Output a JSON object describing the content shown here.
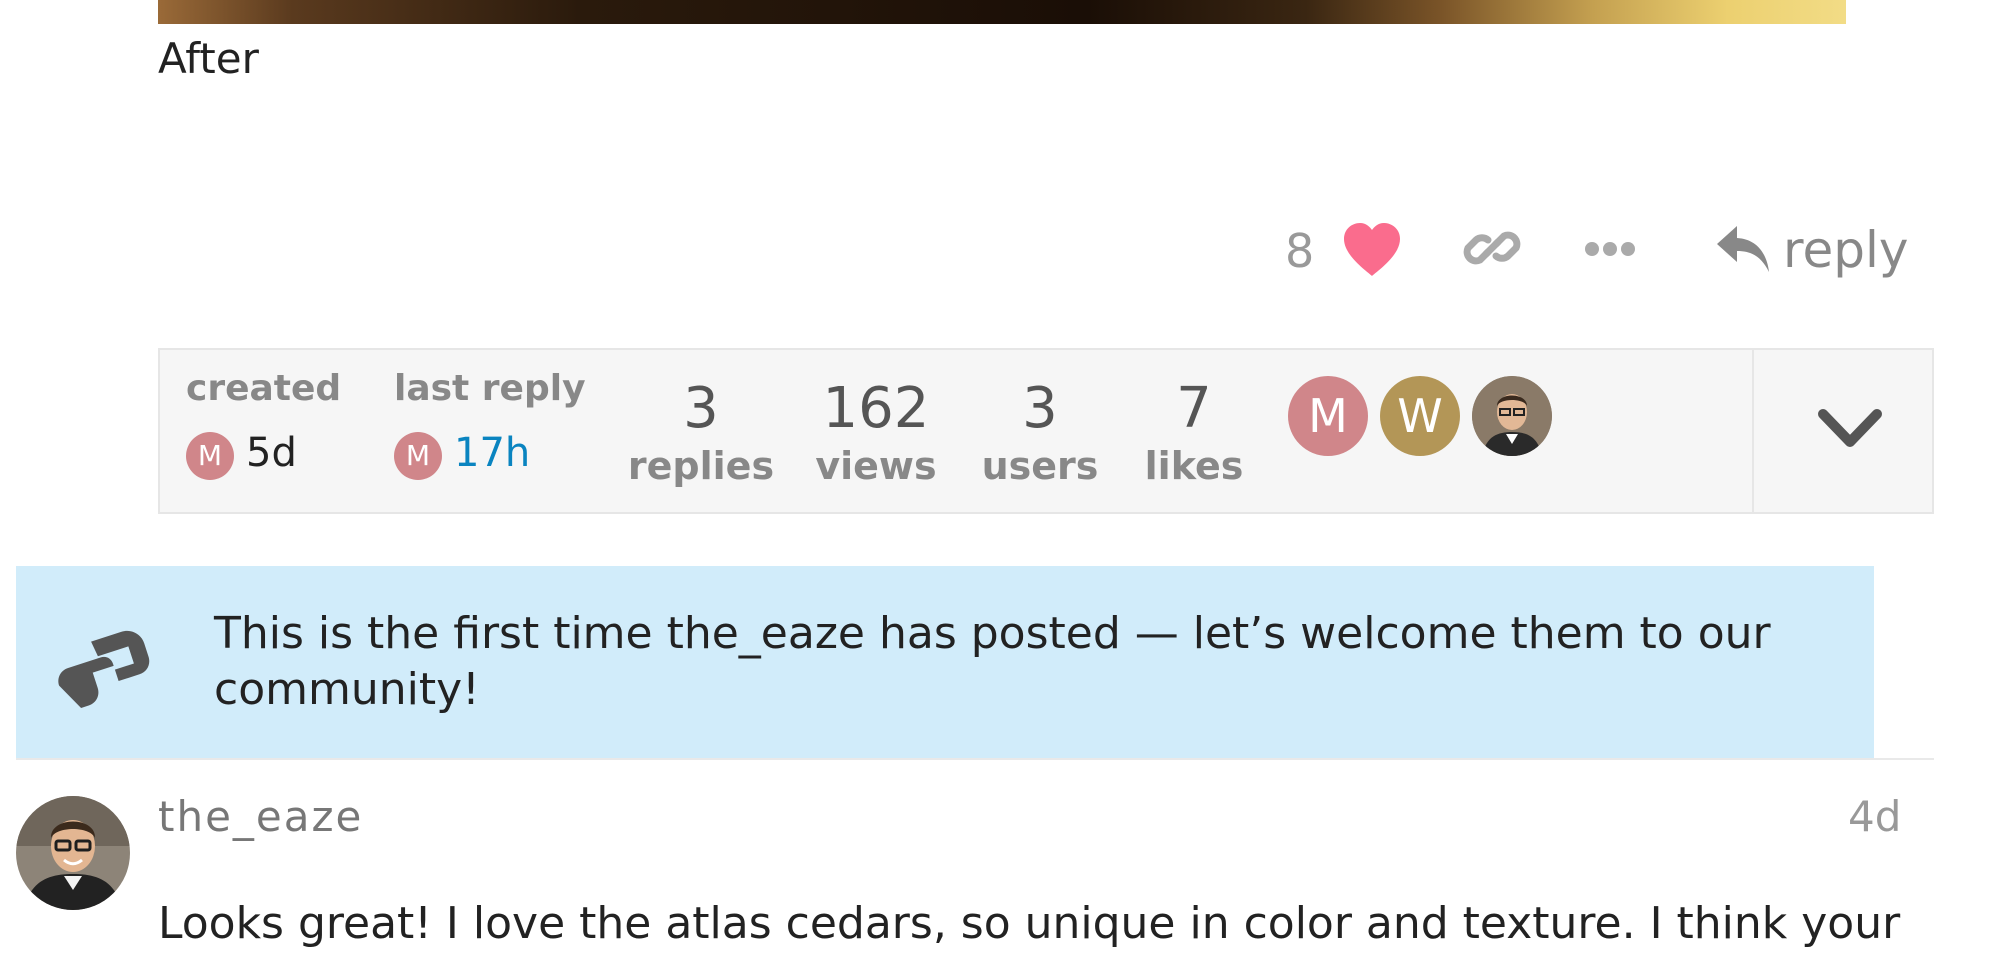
{
  "post": {
    "caption": "After",
    "like_count": "8",
    "reply_label": "reply"
  },
  "summary": {
    "created_label": "created",
    "created_avatar": "M",
    "created_value": "5d",
    "last_reply_label": "last reply",
    "last_reply_avatar": "M",
    "last_reply_value": "17h",
    "stats": [
      {
        "value": "3",
        "label": "replies"
      },
      {
        "value": "162",
        "label": "views"
      },
      {
        "value": "3",
        "label": "users"
      },
      {
        "value": "7",
        "label": "likes"
      }
    ],
    "participants": [
      {
        "initial": "M",
        "color": "#d0868a"
      },
      {
        "initial": "W",
        "color": "#b39657"
      },
      {
        "initial": "",
        "color": "#6a5a4a"
      }
    ]
  },
  "welcome": {
    "text": "This is the first time the_eaze has posted — let’s welcome them to our community!"
  },
  "reply_post": {
    "username": "the_eaze",
    "time": "4d",
    "body": "Looks great! I love the atlas cedars, so unique in color and texture. I think your"
  },
  "colors": {
    "heart": "#fa6c8d",
    "link_blue": "#0a84c0",
    "welcome_bg": "#d1ecfa",
    "summary_bg": "#f6f6f6"
  }
}
